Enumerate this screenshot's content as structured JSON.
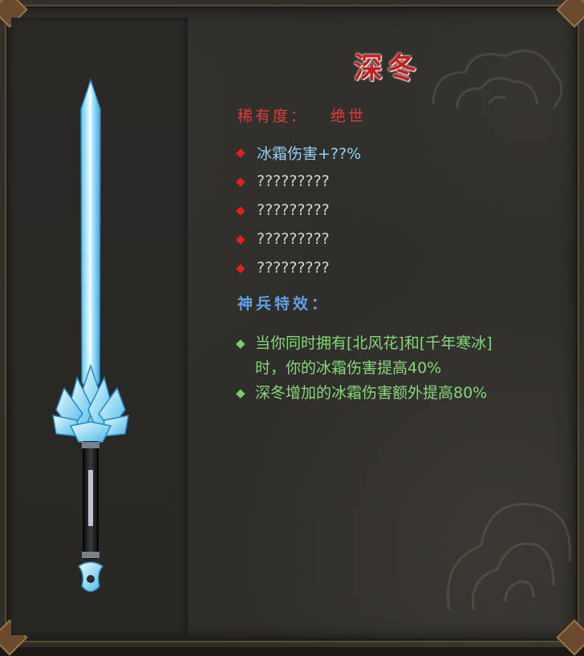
{
  "item": {
    "name": "深冬",
    "rarity_label": "稀有度：",
    "rarity_value": "绝世"
  },
  "stats": [
    {
      "text": "冰霜伤害+??%"
    },
    {
      "text": "?????????"
    },
    {
      "text": "?????????"
    },
    {
      "text": "?????????"
    },
    {
      "text": "?????????"
    }
  ],
  "effects_heading": "神兵特效：",
  "effects": [
    {
      "line1": "当你同时拥有[北风花]和[千年寒冰]",
      "line2": "时，你的冰霜伤害提高40%"
    },
    {
      "line1": "深冬增加的冰霜伤害额外提高80%",
      "line2": ""
    }
  ],
  "icons": {
    "stat_bullet": "red-diamond-icon",
    "effect_bullet": "green-diamond-icon",
    "weapon": "ice-sword-icon"
  },
  "colors": {
    "title": "#c81e1e",
    "rarity": "#e23b3b",
    "first_stat": "#8fd2f5",
    "effect_heading": "#5fa0e6",
    "effect_text": "#86d77a"
  }
}
